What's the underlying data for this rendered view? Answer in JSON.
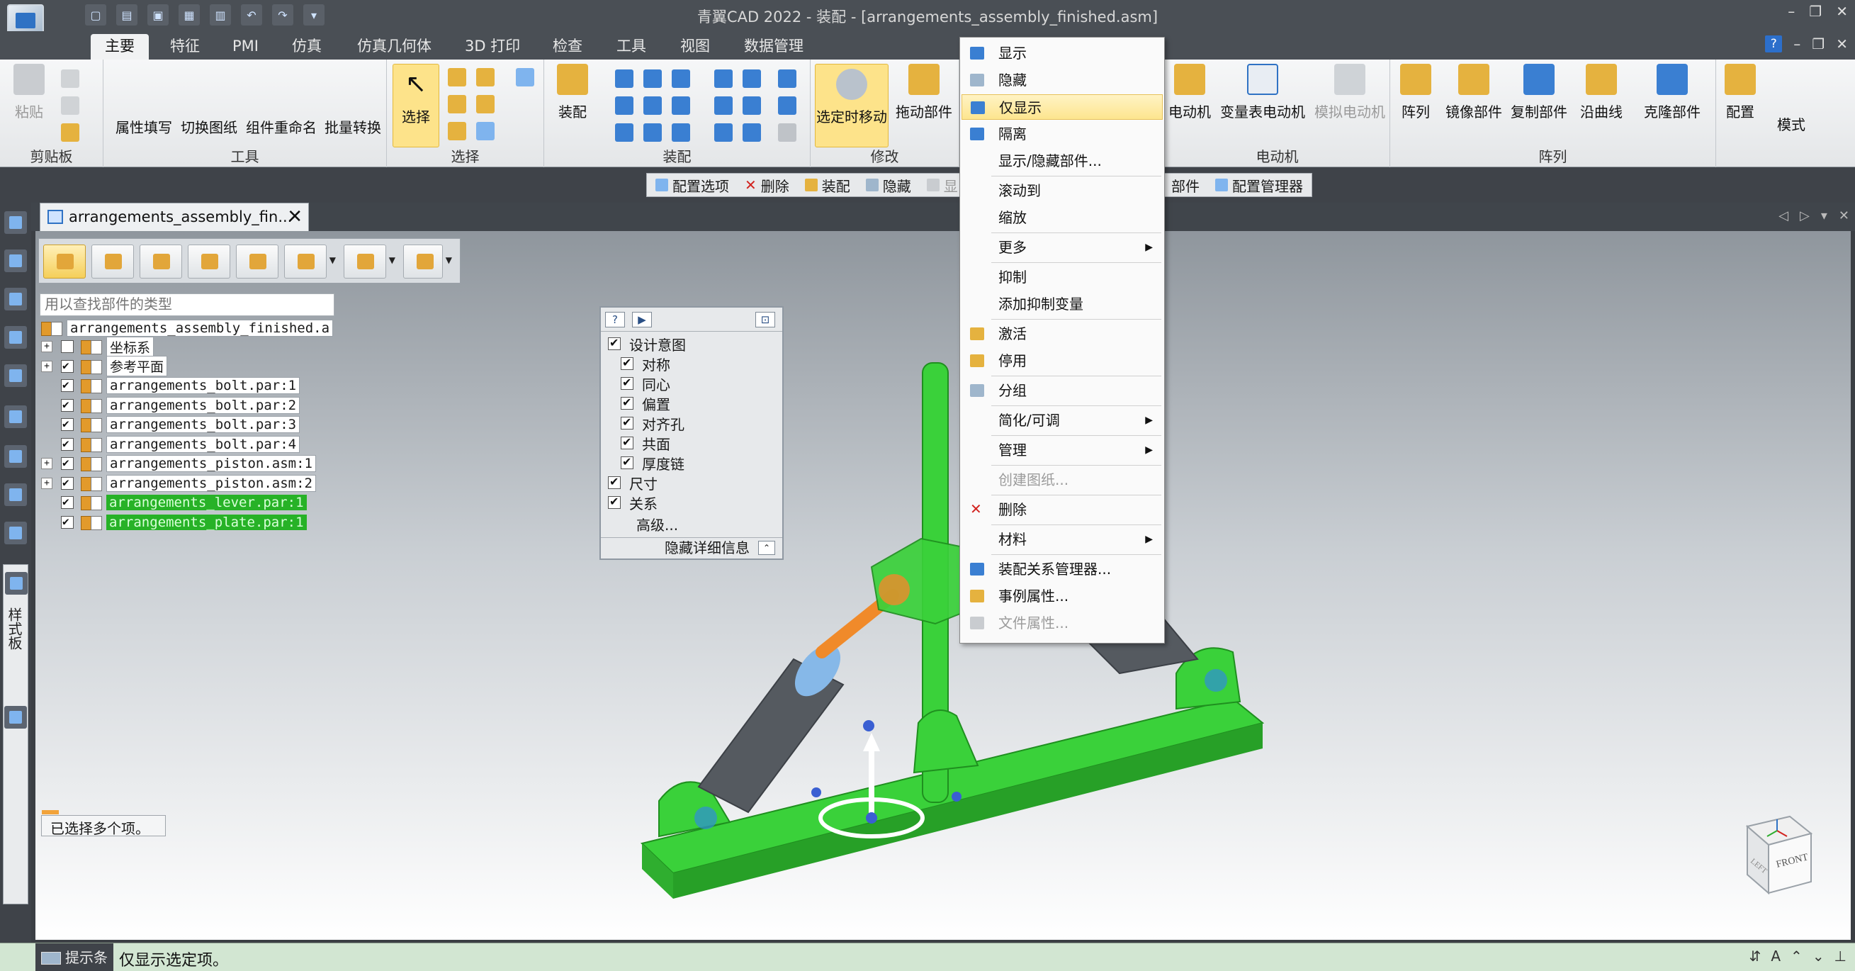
{
  "window": {
    "title": "青翼CAD 2022 - 装配 - [arrangements_assembly_finished.asm]",
    "controls": [
      "–",
      "❐",
      "✕"
    ],
    "doc_controls": [
      "–",
      "❐",
      "✕"
    ]
  },
  "ribbon_tabs": [
    {
      "label": "主要",
      "active": true
    },
    {
      "label": "特征"
    },
    {
      "label": "PMI"
    },
    {
      "label": "仿真"
    },
    {
      "label": "仿真几何体"
    },
    {
      "label": "3D 打印"
    },
    {
      "label": "检查"
    },
    {
      "label": "工具"
    },
    {
      "label": "视图"
    },
    {
      "label": "数据管理"
    }
  ],
  "ribbon": {
    "clipboard": {
      "paste": "粘贴",
      "group": "剪贴板"
    },
    "tools": {
      "b1": "属性填写",
      "b2": "切换图纸",
      "b3": "组件重命名",
      "b4": "批量转换",
      "group": "工具"
    },
    "select": {
      "label": "选择",
      "group": "选择"
    },
    "assemble": {
      "label": "装配",
      "group": "装配"
    },
    "modify": {
      "b1": "选定时移动",
      "b2": "拖动部件",
      "group": "修改"
    },
    "motor": {
      "b1": "电动机",
      "b2": "变量表电动机",
      "b3": "模拟电动机",
      "group": "电动机"
    },
    "pattern": {
      "b1": "阵列",
      "b2": "镜像部件",
      "b3": "复制部件",
      "b4": "沿曲线",
      "b5": "克隆部件",
      "group": "阵列"
    },
    "config": {
      "label": "配置"
    },
    "mode": {
      "label": "模式"
    }
  },
  "command_bar": {
    "items": [
      "配置选项",
      "删除",
      "装配",
      "隐藏",
      "显"
    ],
    "items_right": [
      "部件",
      "配置管理器"
    ]
  },
  "document_tab": {
    "label": "arrangements_assembly_fin...",
    "close": "✕"
  },
  "search": {
    "placeholder": "用以查找部件的类型"
  },
  "tree": {
    "root": "arrangements_assembly_finished.a",
    "items": [
      {
        "label": "坐标系",
        "expander": "+",
        "checked": false,
        "style": "box"
      },
      {
        "label": "参考平面",
        "expander": "+",
        "checked": true,
        "style": "box"
      },
      {
        "label": "arrangements_bolt.par:1",
        "checked": true,
        "style": "box"
      },
      {
        "label": "arrangements_bolt.par:2",
        "checked": true,
        "style": "box"
      },
      {
        "label": "arrangements_bolt.par:3",
        "checked": true,
        "style": "box"
      },
      {
        "label": "arrangements_bolt.par:4",
        "checked": true,
        "style": "box"
      },
      {
        "label": "arrangements_piston.asm:1",
        "expander": "+",
        "checked": true,
        "style": "box"
      },
      {
        "label": "arrangements_piston.asm:2",
        "expander": "+",
        "checked": true,
        "style": "box"
      },
      {
        "label": "arrangements_lever.par:1",
        "checked": true,
        "style": "sel"
      },
      {
        "label": "arrangements_plate.par:1",
        "checked": true,
        "style": "sel"
      }
    ]
  },
  "selection_status": "已选择多个项。",
  "relationship_panel": {
    "help": "?",
    "play": "▶",
    "pin": "⊡",
    "items": [
      {
        "label": "设计意图",
        "checked": true,
        "indent": 0
      },
      {
        "label": "对称",
        "checked": true,
        "indent": 1
      },
      {
        "label": "同心",
        "checked": true,
        "indent": 1
      },
      {
        "label": "偏置",
        "checked": true,
        "indent": 1
      },
      {
        "label": "对齐孔",
        "checked": true,
        "indent": 1
      },
      {
        "label": "共面",
        "checked": true,
        "indent": 1
      },
      {
        "label": "厚度链",
        "checked": true,
        "indent": 1
      },
      {
        "label": "尺寸",
        "checked": true,
        "indent": 0
      },
      {
        "label": "关系",
        "checked": true,
        "indent": 0
      }
    ],
    "advanced": "高级...",
    "footer": "隐藏详细信息"
  },
  "context_menu": {
    "items": [
      {
        "label": "显示",
        "icon": "show-icon"
      },
      {
        "label": "隐藏",
        "icon": "hide-icon"
      },
      {
        "label": "仅显示",
        "icon": "show-only-icon",
        "highlighted": true
      },
      {
        "label": "隔离",
        "icon": "isolate-icon"
      },
      {
        "label": "显示/隐藏部件...",
        "sep_after": true
      },
      {
        "label": "滚动到"
      },
      {
        "label": "缩放",
        "sep_after": true
      },
      {
        "label": "更多",
        "submenu": true,
        "sep_after": true
      },
      {
        "label": "抑制"
      },
      {
        "label": "添加抑制变量",
        "sep_after": true
      },
      {
        "label": "激活",
        "icon": "activate-icon"
      },
      {
        "label": "停用",
        "icon": "deactivate-icon",
        "sep_after": true
      },
      {
        "label": "分组",
        "icon": "group-icon",
        "sep_after": true
      },
      {
        "label": "简化/可调",
        "submenu": true,
        "sep_after": true
      },
      {
        "label": "管理",
        "submenu": true,
        "sep_after": true
      },
      {
        "label": "创建图纸...",
        "disabled": true,
        "sep_after": true
      },
      {
        "label": "删除",
        "icon": "delete-icon",
        "sep_after": true
      },
      {
        "label": "材料",
        "submenu": true,
        "sep_after": true
      },
      {
        "label": "装配关系管理器...",
        "icon": "relationship-manager-icon"
      },
      {
        "label": "事例属性...",
        "icon": "occurrence-properties-icon"
      },
      {
        "label": "文件属性...",
        "icon": "file-properties-icon",
        "disabled": true
      }
    ]
  },
  "vertical_tab_label": "样式板",
  "status_bar": {
    "label": "提示条",
    "text": "仅显示选定项。"
  },
  "view_cube": {
    "front": "FRONT",
    "left": "LEFT"
  },
  "colors": {
    "selection_green": "#3ad13a",
    "highlight": "#fde58f",
    "accent": "#2f72c4"
  }
}
